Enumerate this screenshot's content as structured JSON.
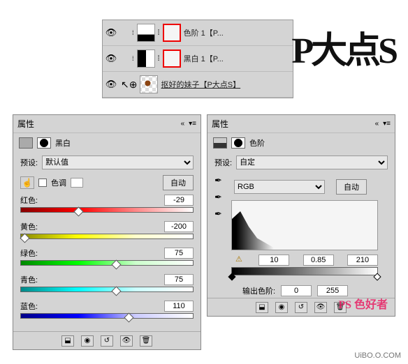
{
  "layers": {
    "row1": {
      "name": "色阶 1【P..."
    },
    "row2": {
      "name": "黑白 1【P..."
    },
    "row3": {
      "name": "抠好的妹子【P大点S】"
    }
  },
  "logo": {
    "text": "P大点S"
  },
  "panelBW": {
    "header": "属性",
    "title": "黑白",
    "preset_label": "预设:",
    "preset_value": "默认值",
    "tint_label": "色调",
    "auto": "自动",
    "sliders": {
      "red": {
        "label": "红色:",
        "value": "-29",
        "pos": 33
      },
      "yellow": {
        "label": "黄色:",
        "value": "-200",
        "pos": 2
      },
      "green": {
        "label": "绿色:",
        "value": "75",
        "pos": 55
      },
      "cyan": {
        "label": "青色:",
        "value": "75",
        "pos": 55
      },
      "blue": {
        "label": "蓝色:",
        "value": "110",
        "pos": 62
      }
    }
  },
  "panelLevels": {
    "header": "属性",
    "title": "色阶",
    "preset_label": "预设:",
    "preset_value": "自定",
    "channel": "RGB",
    "auto": "自动",
    "inputs": {
      "black": "10",
      "gamma": "0.85",
      "white": "210"
    },
    "output_label": "输出色阶:",
    "outputs": {
      "black": "0",
      "white": "255"
    }
  },
  "watermark": {
    "brand": "PS 色好者",
    "url": "UiBO.O.COM"
  }
}
